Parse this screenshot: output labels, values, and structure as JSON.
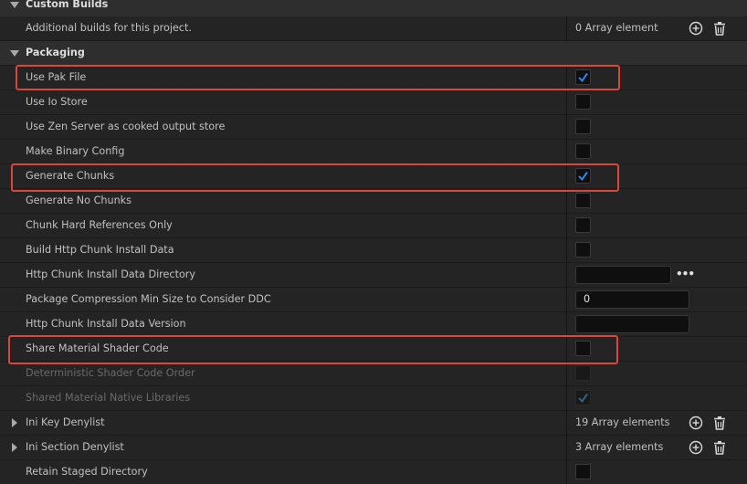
{
  "sections": {
    "custom_builds": "Custom Builds",
    "packaging": "Packaging"
  },
  "rows": {
    "additional_builds": {
      "label": "Additional builds for this project.",
      "value": "0 Array element"
    },
    "use_pak_file": {
      "label": "Use Pak File",
      "checked": true
    },
    "use_io_store": {
      "label": "Use Io Store",
      "checked": false
    },
    "use_zen_server": {
      "label": "Use Zen Server as cooked output store",
      "checked": false
    },
    "make_binary_config": {
      "label": "Make Binary Config",
      "checked": false
    },
    "generate_chunks": {
      "label": "Generate Chunks",
      "checked": true
    },
    "generate_no_chunks": {
      "label": "Generate No Chunks",
      "checked": false
    },
    "chunk_hard_refs": {
      "label": "Chunk Hard References Only",
      "checked": false
    },
    "build_http_chunk": {
      "label": "Build Http Chunk Install Data",
      "checked": false
    },
    "http_chunk_dir": {
      "label": "Http Chunk Install Data Directory",
      "value": "",
      "browse": "•••"
    },
    "compression_min_size": {
      "label": "Package Compression Min Size to Consider DDC",
      "value": "0"
    },
    "http_chunk_version": {
      "label": "Http Chunk Install Data Version",
      "value": ""
    },
    "share_material_shader": {
      "label": "Share Material Shader Code",
      "checked": false
    },
    "deterministic_shader": {
      "label": "Deterministic Shader Code Order",
      "checked": false
    },
    "shared_native_libs": {
      "label": "Shared Material Native Libraries",
      "checked": true
    },
    "ini_key_denylist": {
      "label": "Ini Key Denylist",
      "value": "19 Array elements"
    },
    "ini_section_denylist": {
      "label": "Ini Section Denylist",
      "value": "3 Array elements"
    },
    "retain_staged_dir": {
      "label": "Retain Staged Directory",
      "checked": false
    }
  },
  "colors": {
    "highlight": "#d9473c",
    "check": "#2f86e6"
  }
}
